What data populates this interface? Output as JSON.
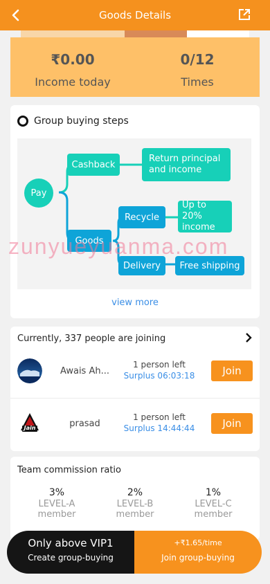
{
  "header": {
    "title": "Goods Details",
    "back_icon": "chevron-left-icon",
    "share_icon": "external-link-icon"
  },
  "income": {
    "income_value": "₹0.00",
    "income_label": "Income today",
    "times_value": "0/12",
    "times_label": "Times"
  },
  "steps": {
    "title": "Group buying steps",
    "nodes": {
      "pay": "Pay",
      "cashback": "Cashback",
      "return": "Return principal and income",
      "goods": "Goods",
      "recycle": "Recycle",
      "up_to": "Up to 20% income",
      "delivery": "Delivery",
      "free_shipping": "Free shipping"
    },
    "view_more": "view more"
  },
  "watermark": "zunyueyuanma.com",
  "joining": {
    "header": "Currently, 337 people are joining",
    "rows": [
      {
        "name": "Awais Ah...",
        "left": "1 person left",
        "surplus": "Surplus 06:03:18",
        "button": "Join"
      },
      {
        "name": "prasad",
        "avatar_text": "Jain",
        "left": "1 person left",
        "surplus": "Surplus 14:44:44",
        "button": "Join"
      }
    ]
  },
  "commission": {
    "title": "Team commission ratio",
    "levels": [
      {
        "pct": "3%",
        "name": "LEVEL-A",
        "member": "member"
      },
      {
        "pct": "2%",
        "name": "LEVEL-B",
        "member": "member"
      },
      {
        "pct": "1%",
        "name": "LEVEL-C",
        "member": "member"
      }
    ]
  },
  "bottom": {
    "create_title": "Only above VIP1",
    "create_label": "Create group-buying",
    "join_rate": "+₹1.65/time",
    "join_label": "Join group-buying"
  },
  "colors": {
    "accent": "#f5911e",
    "teal": "#17d0b8",
    "blue": "#0ea4d8",
    "link": "#3a8ee6"
  }
}
